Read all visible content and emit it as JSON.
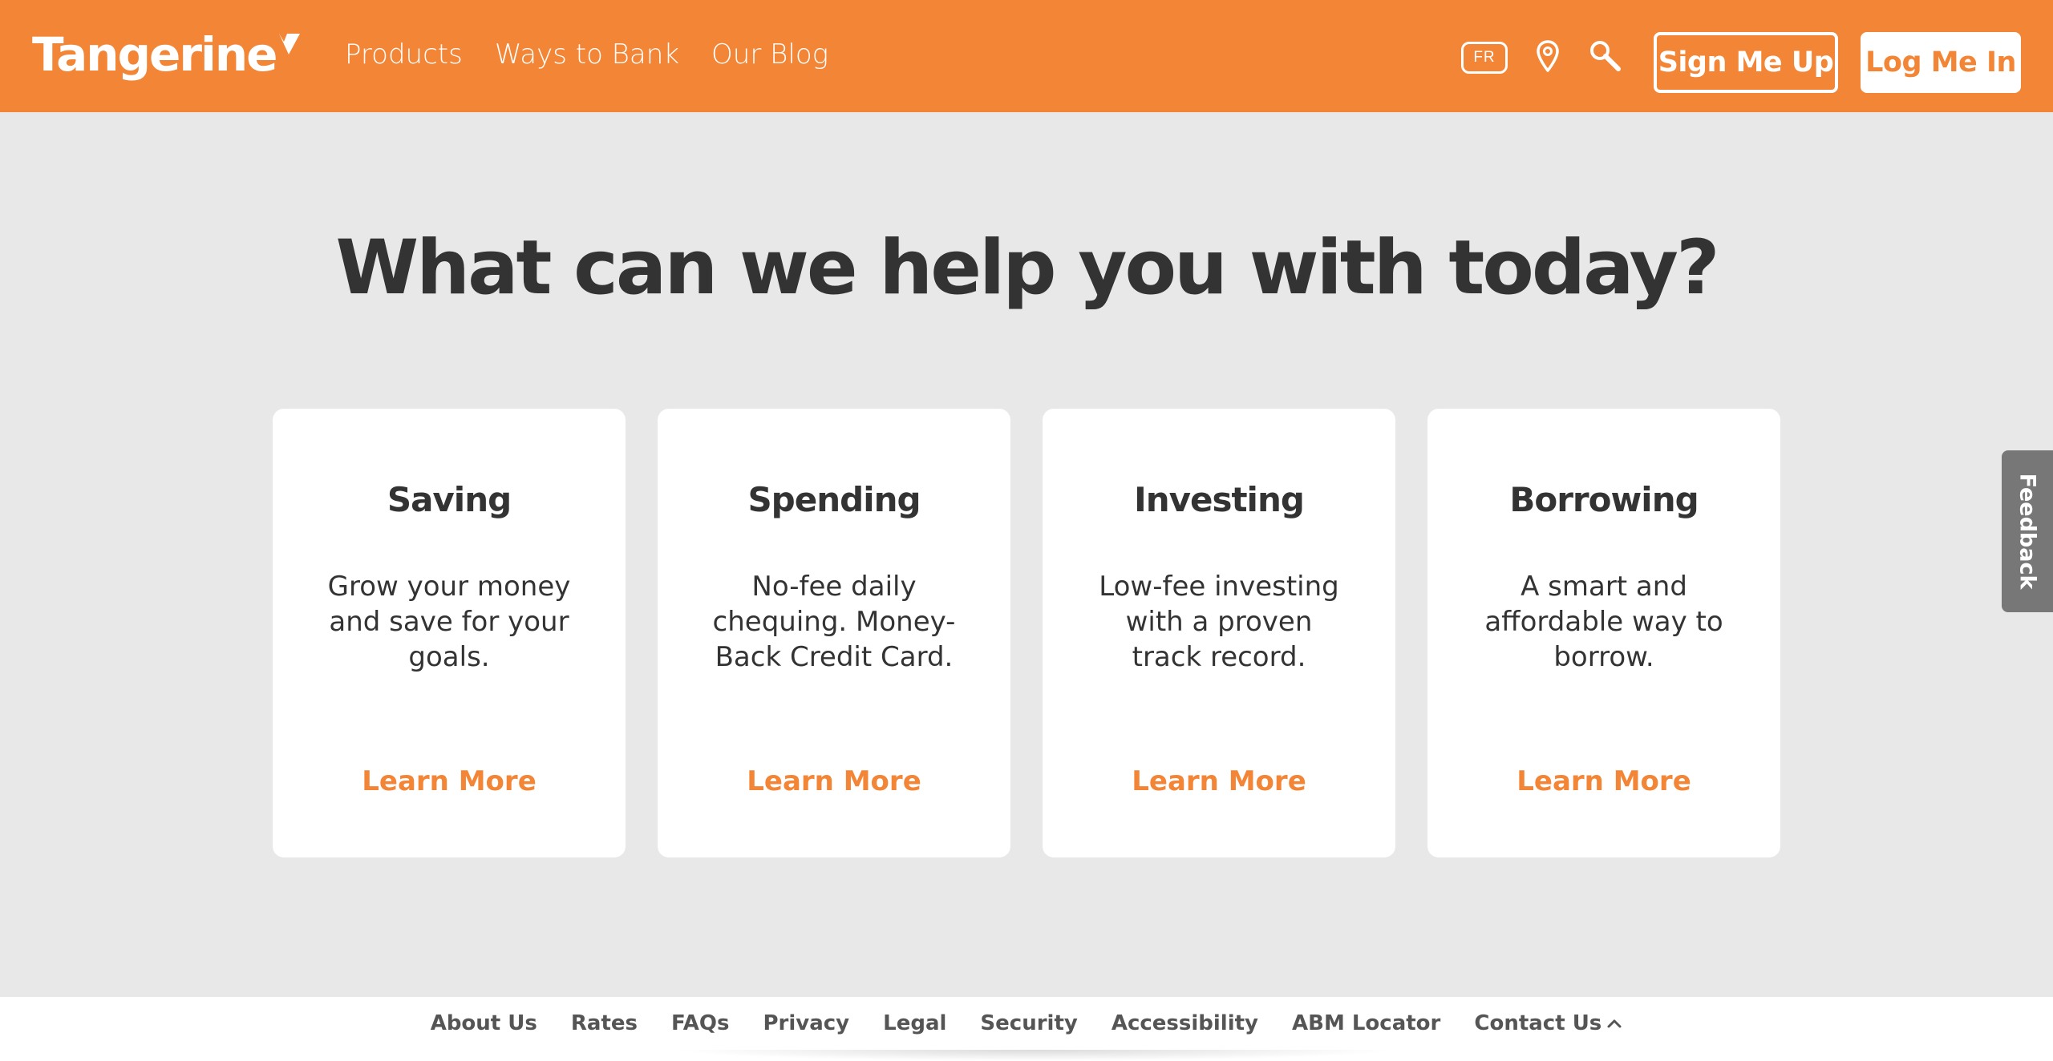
{
  "header": {
    "logo_text": "Tangerine",
    "nav": [
      "Products",
      "Ways to Bank",
      "Our Blog"
    ],
    "language_badge": "FR",
    "sign_up_label": "Sign Me Up",
    "log_in_label": "Log Me In"
  },
  "main": {
    "title": "What can we help you with today?",
    "cards": [
      {
        "title": "Saving",
        "description": "Grow your money and save for your goals.",
        "link": "Learn More"
      },
      {
        "title": "Spending",
        "description": "No-fee daily chequing. Money-Back Credit Card.",
        "link": "Learn More"
      },
      {
        "title": "Investing",
        "description": "Low-fee investing with a proven track record.",
        "link": "Learn More"
      },
      {
        "title": "Borrowing",
        "description": "A smart and affordable way to borrow.",
        "link": "Learn More"
      }
    ]
  },
  "feedback_label": "Feedback",
  "footer": {
    "links": [
      "About Us",
      "Rates",
      "FAQs",
      "Privacy",
      "Legal",
      "Security",
      "Accessibility",
      "ABM Locator"
    ],
    "contact_label": "Contact Us"
  },
  "colors": {
    "brand_orange": "#f28536",
    "page_background": "#e8e8e8",
    "text_dark": "#333333"
  },
  "icons": [
    "location-pin-icon",
    "search-icon",
    "chevron-up-icon"
  ]
}
